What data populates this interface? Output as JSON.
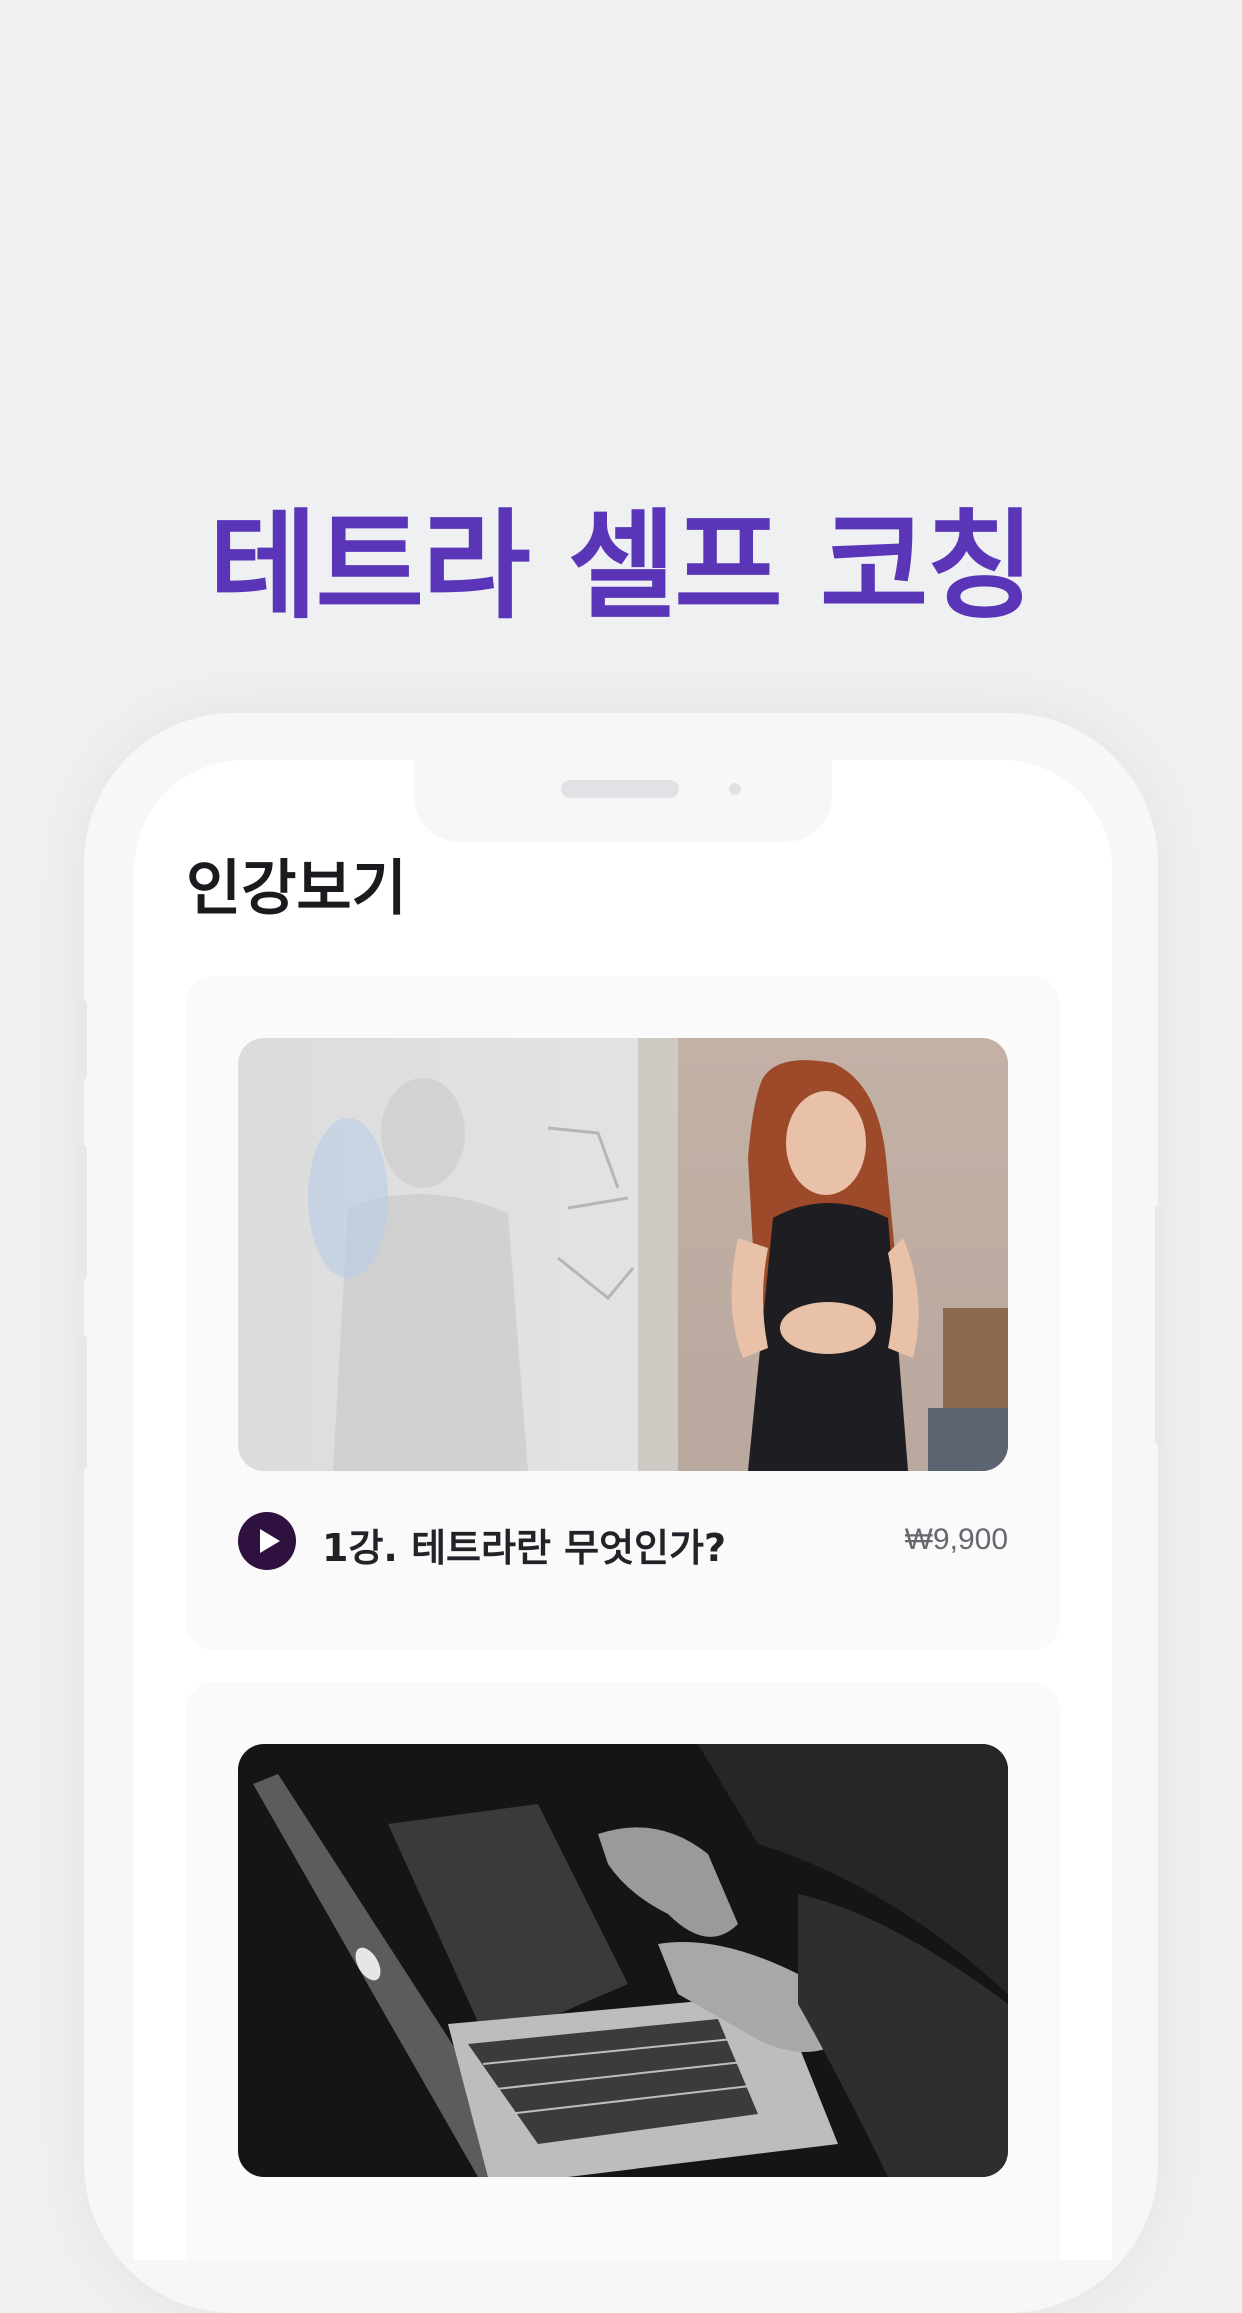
{
  "headline": "테트라 셀프 코칭",
  "screen": {
    "title": "인강보기",
    "lessons": [
      {
        "title": "1강. 테트라란 무엇인가?",
        "price": "₩9,900",
        "thumbnail": "woman-presenting-at-whiteboard"
      },
      {
        "thumbnail": "hands-typing-on-laptop"
      }
    ]
  },
  "colors": {
    "accent": "#5a35b8",
    "play_button": "#2f1140",
    "background": "#eef0f2"
  },
  "icons": [
    "play-icon"
  ]
}
